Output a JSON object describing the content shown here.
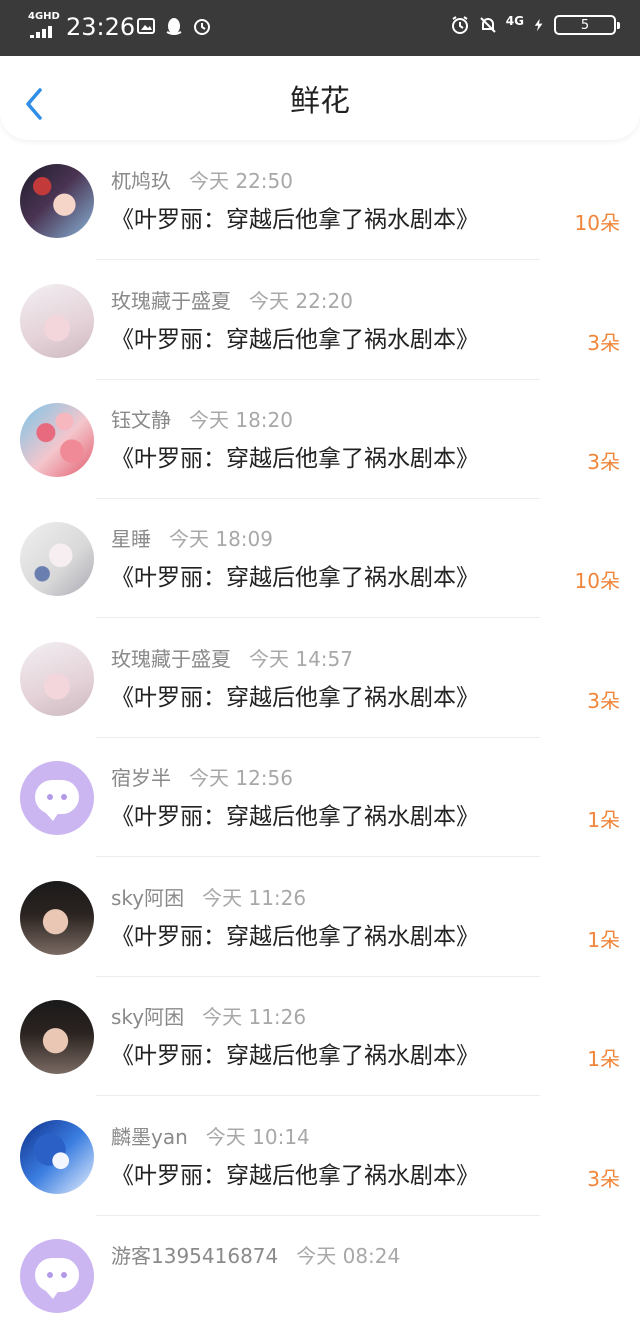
{
  "status_bar": {
    "network_tag": "4GHD",
    "time": "23:26",
    "mobile_network": "4G",
    "battery_level": "5"
  },
  "header": {
    "title": "鲜花"
  },
  "rows": [
    {
      "name": "杌鸠玖",
      "time": "今天 22:50",
      "book": "《叶罗丽：穿越后他拿了祸水剧本》",
      "count": "10朵"
    },
    {
      "name": "玫瑰藏于盛夏",
      "time": "今天 22:20",
      "book": "《叶罗丽：穿越后他拿了祸水剧本》",
      "count": "3朵"
    },
    {
      "name": "钰文静",
      "time": "今天 18:20",
      "book": "《叶罗丽：穿越后他拿了祸水剧本》",
      "count": "3朵"
    },
    {
      "name": "星睡",
      "time": "今天 18:09",
      "book": "《叶罗丽：穿越后他拿了祸水剧本》",
      "count": "10朵"
    },
    {
      "name": "玫瑰藏于盛夏",
      "time": "今天 14:57",
      "book": "《叶罗丽：穿越后他拿了祸水剧本》",
      "count": "3朵"
    },
    {
      "name": "宿岁半",
      "time": "今天 12:56",
      "book": "《叶罗丽：穿越后他拿了祸水剧本》",
      "count": "1朵"
    },
    {
      "name": "sky阿困",
      "time": "今天 11:26",
      "book": "《叶罗丽：穿越后他拿了祸水剧本》",
      "count": "1朵"
    },
    {
      "name": "sky阿困",
      "time": "今天 11:26",
      "book": "《叶罗丽：穿越后他拿了祸水剧本》",
      "count": "1朵"
    },
    {
      "name": "麟墨yan",
      "time": "今天 10:14",
      "book": "《叶罗丽：穿越后他拿了祸水剧本》",
      "count": "3朵"
    },
    {
      "name": "游客1395416874",
      "time": "今天 08:24",
      "book": "",
      "count": ""
    }
  ],
  "colors": {
    "accent_blue": "#2f8fe8",
    "count_orange": "#f0853a",
    "status_bar_bg": "#3a3a3a"
  }
}
